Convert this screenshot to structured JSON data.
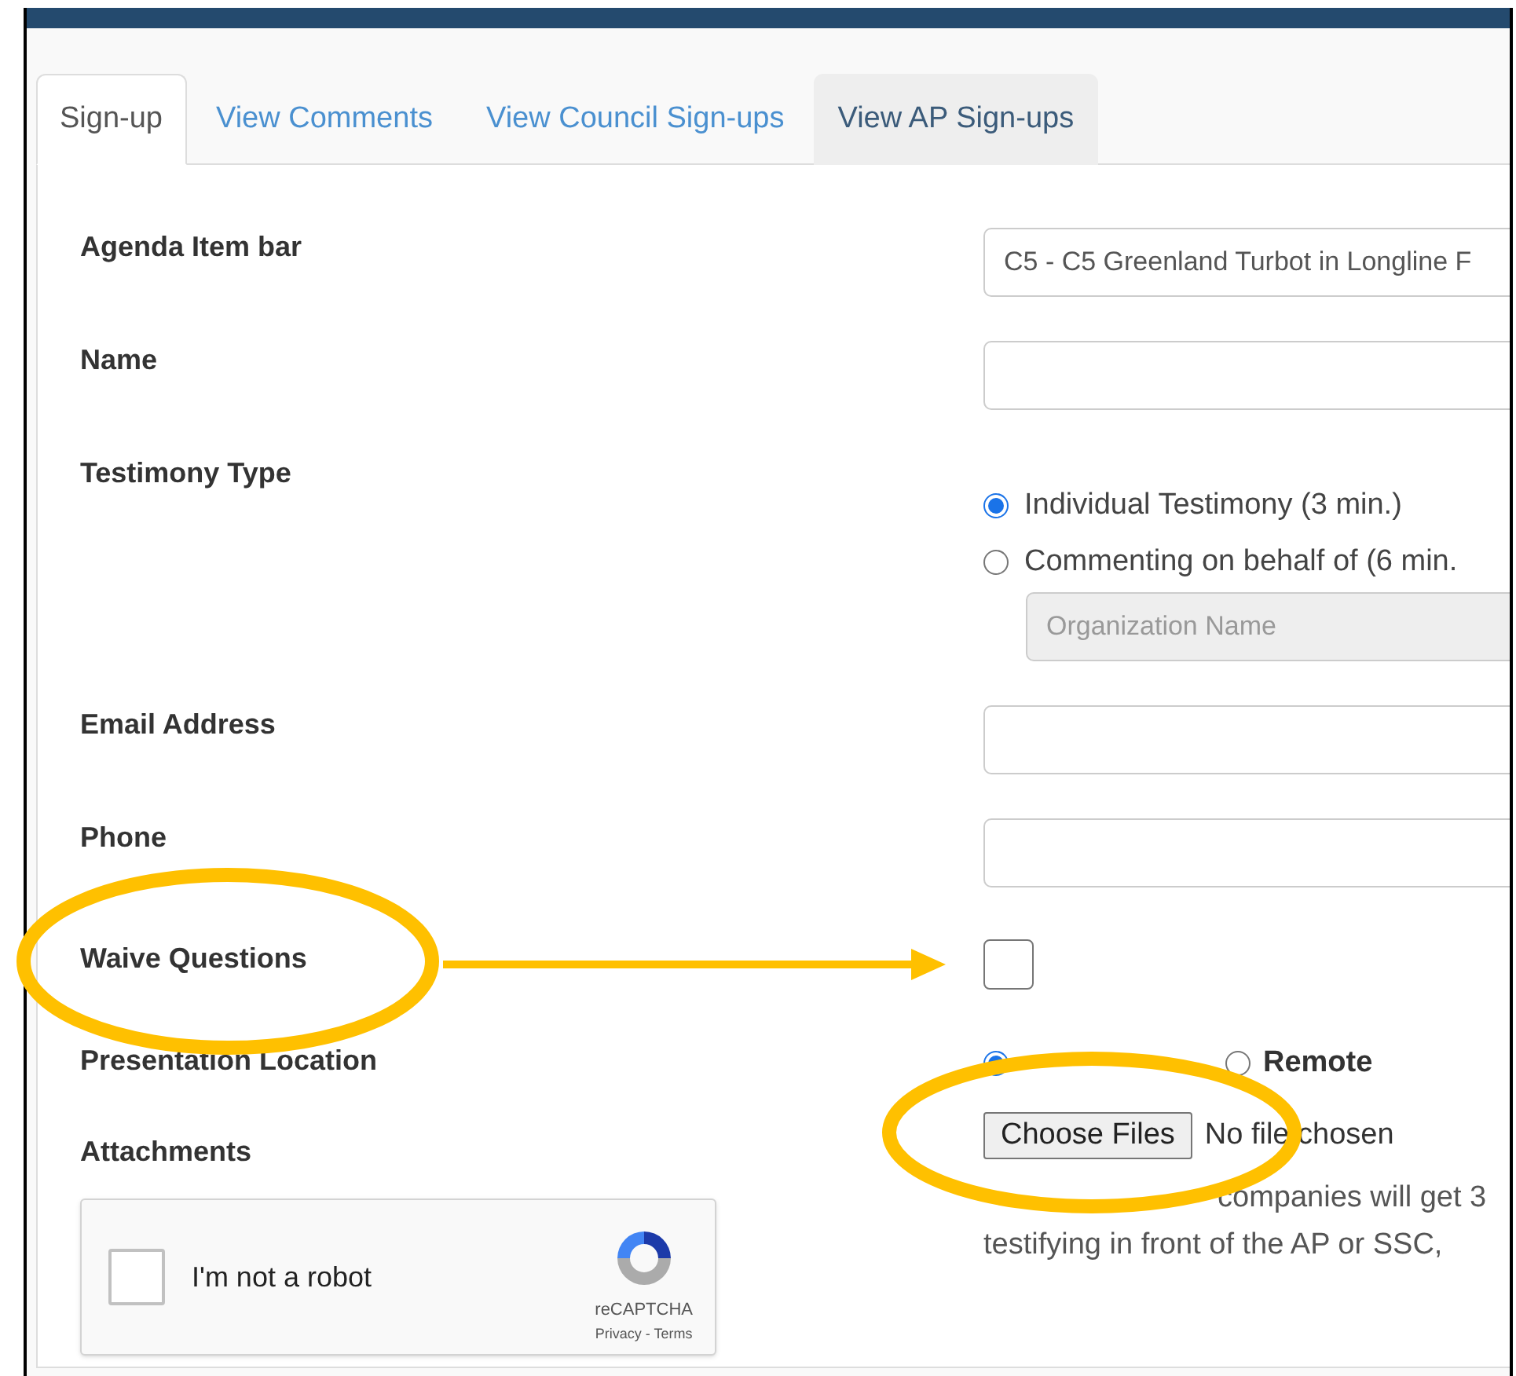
{
  "tabs": [
    {
      "label": "Sign-up",
      "selected": true,
      "highlighted": false
    },
    {
      "label": "View Comments",
      "selected": false,
      "highlighted": false
    },
    {
      "label": "View Council Sign-ups",
      "selected": false,
      "highlighted": false
    },
    {
      "label": "View AP Sign-ups",
      "selected": false,
      "highlighted": true
    }
  ],
  "fields": [
    {
      "kind": "text",
      "label": "Agenda Item bar",
      "value": "C5 - C5 Greenland Turbot in Longline F"
    },
    {
      "kind": "text",
      "label": "Name"
    },
    {
      "kind": "radio",
      "label": "Testimony Type",
      "options": [
        {
          "label": "Individual Testimony (3 min.)",
          "selected": true
        },
        {
          "label": "Commenting on behalf of (6 min.",
          "selected": false
        }
      ],
      "placeholder": "Organization Name"
    },
    {
      "kind": "text",
      "label": "Email Address"
    },
    {
      "kind": "text",
      "label": "Phone"
    },
    {
      "kind": "checkbox",
      "label": "Waive Questions",
      "checked": false
    },
    {
      "kind": "inline_radio",
      "label": "Presentation Location",
      "options": [
        {
          "selected": true
        },
        {
          "label": "Remote",
          "selected": false
        }
      ]
    },
    {
      "kind": "file",
      "label": "Attachments",
      "button": "Choose Files",
      "status": "No file chosen",
      "help_lines": [
        "companies will get 3",
        "testifying in front of the AP or SSC,"
      ]
    }
  ],
  "captcha": {
    "checked": false,
    "label": "I'm not a robot",
    "brand": "reCAPTCHA",
    "links": "Privacy - Terms"
  }
}
